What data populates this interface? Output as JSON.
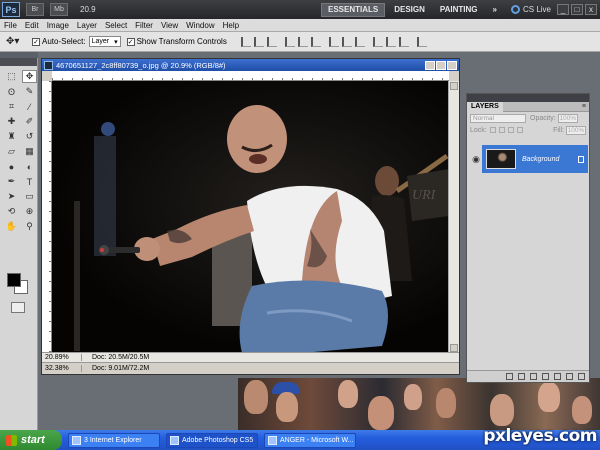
{
  "appbar": {
    "logo": "Ps",
    "zoom": "20.9",
    "workspaces": [
      "ESSENTIALS",
      "DESIGN",
      "PAINTING"
    ],
    "more": "»",
    "cslive": "CS Live",
    "window_buttons": [
      "_",
      "□",
      "x"
    ]
  },
  "menu": [
    "File",
    "Edit",
    "Image",
    "Layer",
    "Select",
    "Filter",
    "View",
    "Window",
    "Help"
  ],
  "options": {
    "auto_select_label": "Auto-Select:",
    "auto_select_value": "Layer",
    "show_transform_label": "Show Transform Controls"
  },
  "document": {
    "title": "4670651127_2c8ff80739_o.jpg @ 20.9% (RGB/8#)",
    "status_zoom": "20.89%",
    "status_doc": "Doc: 20.5M/20.5M",
    "status_zoom_2": "32.38%",
    "status_doc_2": "Doc: 9.01M/72.2M"
  },
  "layers": {
    "tab": "LAYERS",
    "blend_mode": "Normal",
    "opacity_label": "Opacity:",
    "opacity": "100%",
    "lock_label": "Lock:",
    "fill_label": "Fill:",
    "fill": "100%",
    "layer_name": "Background"
  },
  "taskbar": {
    "start": "start",
    "tasks": [
      "3 Internet Explorer",
      "Adobe Photoshop CS5",
      "ANGER - Microsoft W..."
    ]
  },
  "watermark": "pxleyes.com",
  "colors": {
    "accent": "#3b78d4",
    "titlebar": "#1f4ea8",
    "taskbar": "#245ede"
  }
}
